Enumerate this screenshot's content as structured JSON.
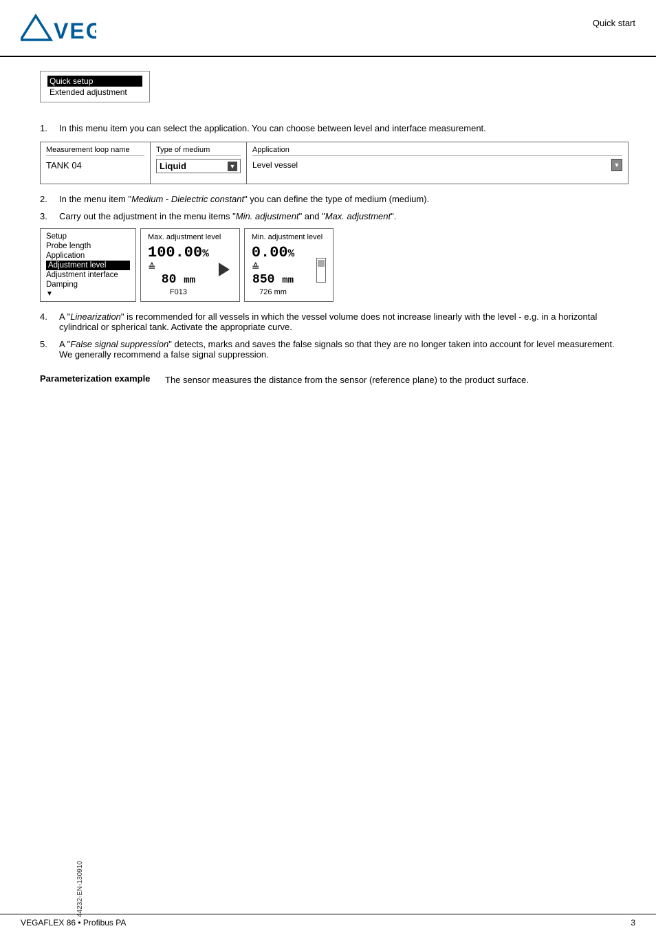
{
  "header": {
    "logo_text": "VEGA",
    "section_title": "Quick start"
  },
  "menu_box": {
    "item1": "Quick setup",
    "item2": "Extended adjustment"
  },
  "step1": {
    "number": "1.",
    "text": "In this menu item you can select the application. You can choose between level and interface measurement."
  },
  "panel1": {
    "col1_label": "Measurement loop name",
    "col1_value": "TANK 04",
    "col2_label": "Type of medium",
    "col2_value": "Liquid",
    "col3_label": "Application",
    "col3_value": "Level vessel"
  },
  "step2": {
    "number": "2.",
    "text_before": "In the menu item \"",
    "text_italic": "Medium - Dielectric constant",
    "text_after": "\" you can define the type of medium (medium)."
  },
  "step3": {
    "number": "3.",
    "text_before": "Carry out the adjustment in the menu items \"",
    "text_italic1": "Min. adjustment",
    "text_mid": "\" and \"",
    "text_italic2": "Max. adjustment",
    "text_after": "\"."
  },
  "panel2": {
    "left_label": "Setup",
    "left_items": [
      "Probe length",
      "Application",
      "Adjustment level",
      "Adjustment interface",
      "Damping"
    ],
    "left_highlighted": "Adjustment level",
    "mid_label": "Max. adjustment level",
    "mid_value1": "100.00%",
    "mid_equal": "≙",
    "mid_value2": "80 mm",
    "mid_sub": "F013",
    "right_label": "Min. adjustment level",
    "right_value1": "0.00%",
    "right_equal": "≙",
    "right_value2": "850 mm",
    "right_sub": "726  mm"
  },
  "step4": {
    "number": "4.",
    "text_before": "A \"",
    "text_italic": "Linearization",
    "text_after": "\" is recommended for all vessels in which the vessel volume does not increase linearly with the level - e.g. in a horizontal cylindrical or spherical tank. Activate the appropriate curve."
  },
  "step5": {
    "number": "5.",
    "text_before": "A \"",
    "text_italic": "False signal suppression",
    "text_after": "\" detects, marks and saves the false signals so that they are no longer taken into account for level measurement. We generally recommend a false signal suppression."
  },
  "param_example": {
    "label": "Parameterization example",
    "text": "The sensor measures the distance from the sensor (reference plane) to the product surface."
  },
  "footer": {
    "left": "VEGAFLEX 86 • Profibus PA",
    "right": "3"
  },
  "side_text": "44232-EN-130910"
}
